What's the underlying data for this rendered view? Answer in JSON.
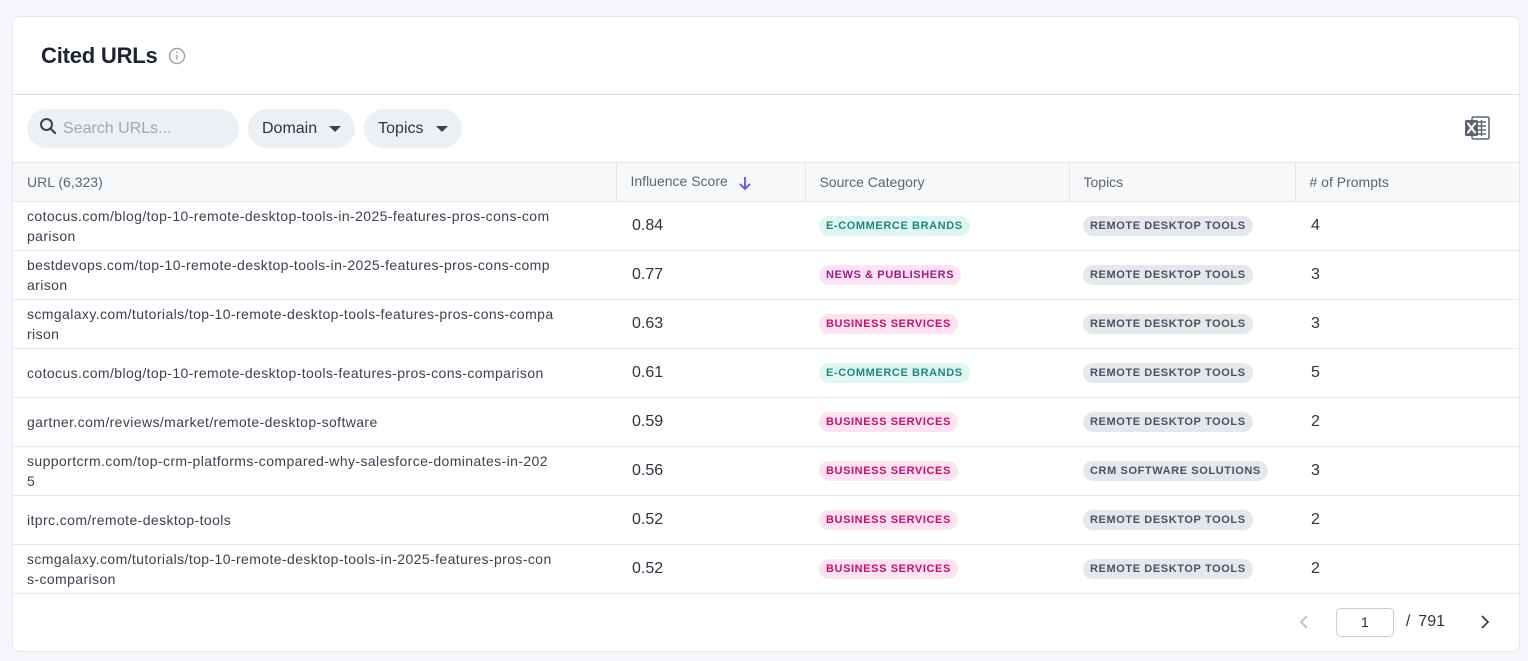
{
  "card": {
    "title": "Cited URLs"
  },
  "toolbar": {
    "search_placeholder": "Search URLs...",
    "domain_label": "Domain",
    "topics_label": "Topics"
  },
  "table": {
    "headers": {
      "url": "URL (6,323)",
      "influence": "Influence Score",
      "category": "Source Category",
      "topics": "Topics",
      "prompts": "# of Prompts"
    },
    "category_colors": {
      "E-COMMERCE BRANDS": {
        "bg": "#e0f6f3",
        "fg": "#1c8a7f"
      },
      "NEWS & PUBLISHERS": {
        "bg": "#fbe3f6",
        "fg": "#a01b8c"
      },
      "BUSINESS SERVICES": {
        "bg": "#fde2ef",
        "fg": "#c5106d"
      }
    },
    "rows": [
      {
        "url": "cotocus.com/blog/top-10-remote-desktop-tools-in-2025-features-pros-cons-comparison",
        "score": "0.84",
        "category": "E-COMMERCE BRANDS",
        "topic": "REMOTE DESKTOP TOOLS",
        "prompts": "4"
      },
      {
        "url": "bestdevops.com/top-10-remote-desktop-tools-in-2025-features-pros-cons-comparison",
        "score": "0.77",
        "category": "NEWS & PUBLISHERS",
        "topic": "REMOTE DESKTOP TOOLS",
        "prompts": "3"
      },
      {
        "url": "scmgalaxy.com/tutorials/top-10-remote-desktop-tools-features-pros-cons-comparison",
        "score": "0.63",
        "category": "BUSINESS SERVICES",
        "topic": "REMOTE DESKTOP TOOLS",
        "prompts": "3"
      },
      {
        "url": "cotocus.com/blog/top-10-remote-desktop-tools-features-pros-cons-comparison",
        "score": "0.61",
        "category": "E-COMMERCE BRANDS",
        "topic": "REMOTE DESKTOP TOOLS",
        "prompts": "5"
      },
      {
        "url": "gartner.com/reviews/market/remote-desktop-software",
        "score": "0.59",
        "category": "BUSINESS SERVICES",
        "topic": "REMOTE DESKTOP TOOLS",
        "prompts": "2"
      },
      {
        "url": "supportcrm.com/top-crm-platforms-compared-why-salesforce-dominates-in-2025",
        "score": "0.56",
        "category": "BUSINESS SERVICES",
        "topic": "CRM SOFTWARE SOLUTIONS",
        "prompts": "3"
      },
      {
        "url": "itprc.com/remote-desktop-tools",
        "score": "0.52",
        "category": "BUSINESS SERVICES",
        "topic": "REMOTE DESKTOP TOOLS",
        "prompts": "2"
      },
      {
        "url": "scmgalaxy.com/tutorials/top-10-remote-desktop-tools-in-2025-features-pros-cons-comparison",
        "score": "0.52",
        "category": "BUSINESS SERVICES",
        "topic": "REMOTE DESKTOP TOOLS",
        "prompts": "2"
      }
    ]
  },
  "pagination": {
    "current_page": "1",
    "separator": "/",
    "total_pages": "791"
  },
  "icons": {
    "search": "search-icon",
    "info": "info-icon",
    "excel": "excel-export-icon",
    "sort": "arrow-down-icon",
    "prev": "chevron-left-icon",
    "next": "chevron-right-icon"
  },
  "colors": {
    "accent": "#6b4fe0"
  }
}
